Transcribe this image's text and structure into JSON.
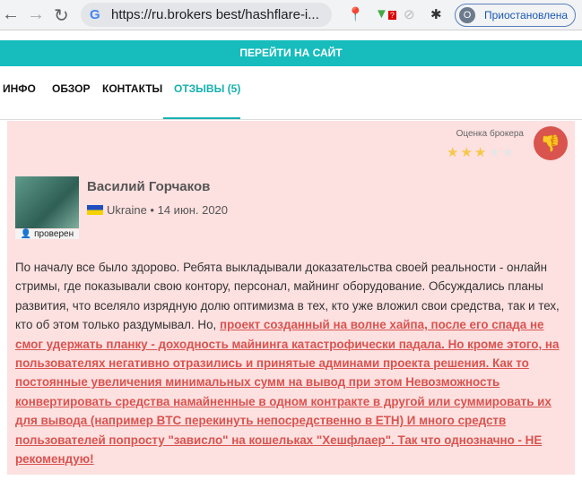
{
  "browser": {
    "url": "https://ru.brokers best/hashflare-i...",
    "profile_initial": "O",
    "profile_label": "Приостановлена",
    "ext_badge": "?"
  },
  "cta": "ПЕРЕЙТИ НА САЙТ",
  "tabs": [
    {
      "label": "ИНФО"
    },
    {
      "label": "ОБЗОР"
    },
    {
      "label": "КОНТАКТЫ"
    },
    {
      "label": "ОТЗЫВЫ (5)"
    }
  ],
  "review": {
    "rating_label": "Оценка брокера",
    "rating": 3,
    "rating_max": 5,
    "verified": "проверен",
    "author": "Василий Горчаков",
    "country": "Ukraine",
    "separator": "•",
    "date": "14 июн. 2020",
    "text_plain": "По началу все было здорово. Ребята выкладывали доказательства своей реальности - онлайн стримы, где показывали свою контору, персонал, майнинг оборудование. Обсуждались планы развития, что вселяло изрядную долю оптимизма в тех, кто уже вложил свои средства, так и тех, кто об этом только раздумывал. Но, ",
    "text_highlight": "проект созданный на волне хайпа, после его спада не смог удержать планку - доходность майнинга катастрофически падала. Но кроме этого, на пользователях негативно отразились и принятые админами проекта решения. Как то постоянные увеличения минимальных сумм на вывод при этом Невозможность конвертировать средства намайненные в одном контракте в другой или суммировать их для вывода (например BTC перекинуть непосредственно в ETH) И много средств пользователей попросту \"зависло\" на кошельках \"Хешфлаер\". Так что однозначно - НЕ рекомендую!"
  }
}
